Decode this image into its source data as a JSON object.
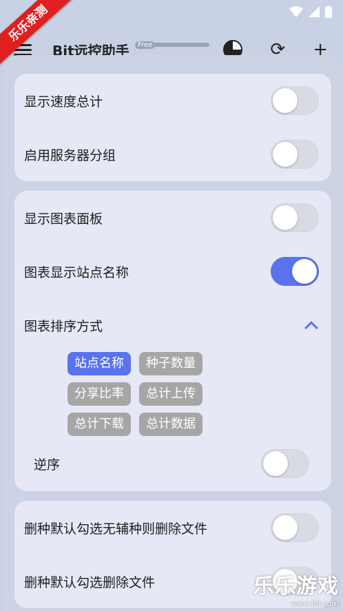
{
  "statusbar": {
    "battery_glyph": "battery-icon"
  },
  "appbar": {
    "title": "Bit远控助手",
    "badge": "Free"
  },
  "ribbon": "乐乐亲测",
  "group1": [
    {
      "label": "显示速度总计",
      "on": false
    },
    {
      "label": "启用服务器分组",
      "on": false
    }
  ],
  "group2": {
    "show_chart": {
      "label": "显示图表面板",
      "on": false
    },
    "chart_names": {
      "label": "图表显示站点名称",
      "on": true
    },
    "sort_title": "图表排序方式",
    "chips": [
      "站点名称",
      "种子数量",
      "分享比率",
      "总计上传",
      "总计下载",
      "总计数据"
    ],
    "active_chip": "站点名称",
    "reverse": {
      "label": "逆序",
      "on": false
    }
  },
  "group3": [
    {
      "label": "删种默认勾选无辅种则删除文件",
      "on": false
    },
    {
      "label": "删种默认勾选删除文件",
      "on": false
    }
  ],
  "watermark": {
    "title": "乐乐游戏",
    "url": "www.6ll.com"
  },
  "colors": {
    "accent": "#5a72ee",
    "chip_inactive": "#a6a6a6",
    "card": "#e6e8f5"
  }
}
